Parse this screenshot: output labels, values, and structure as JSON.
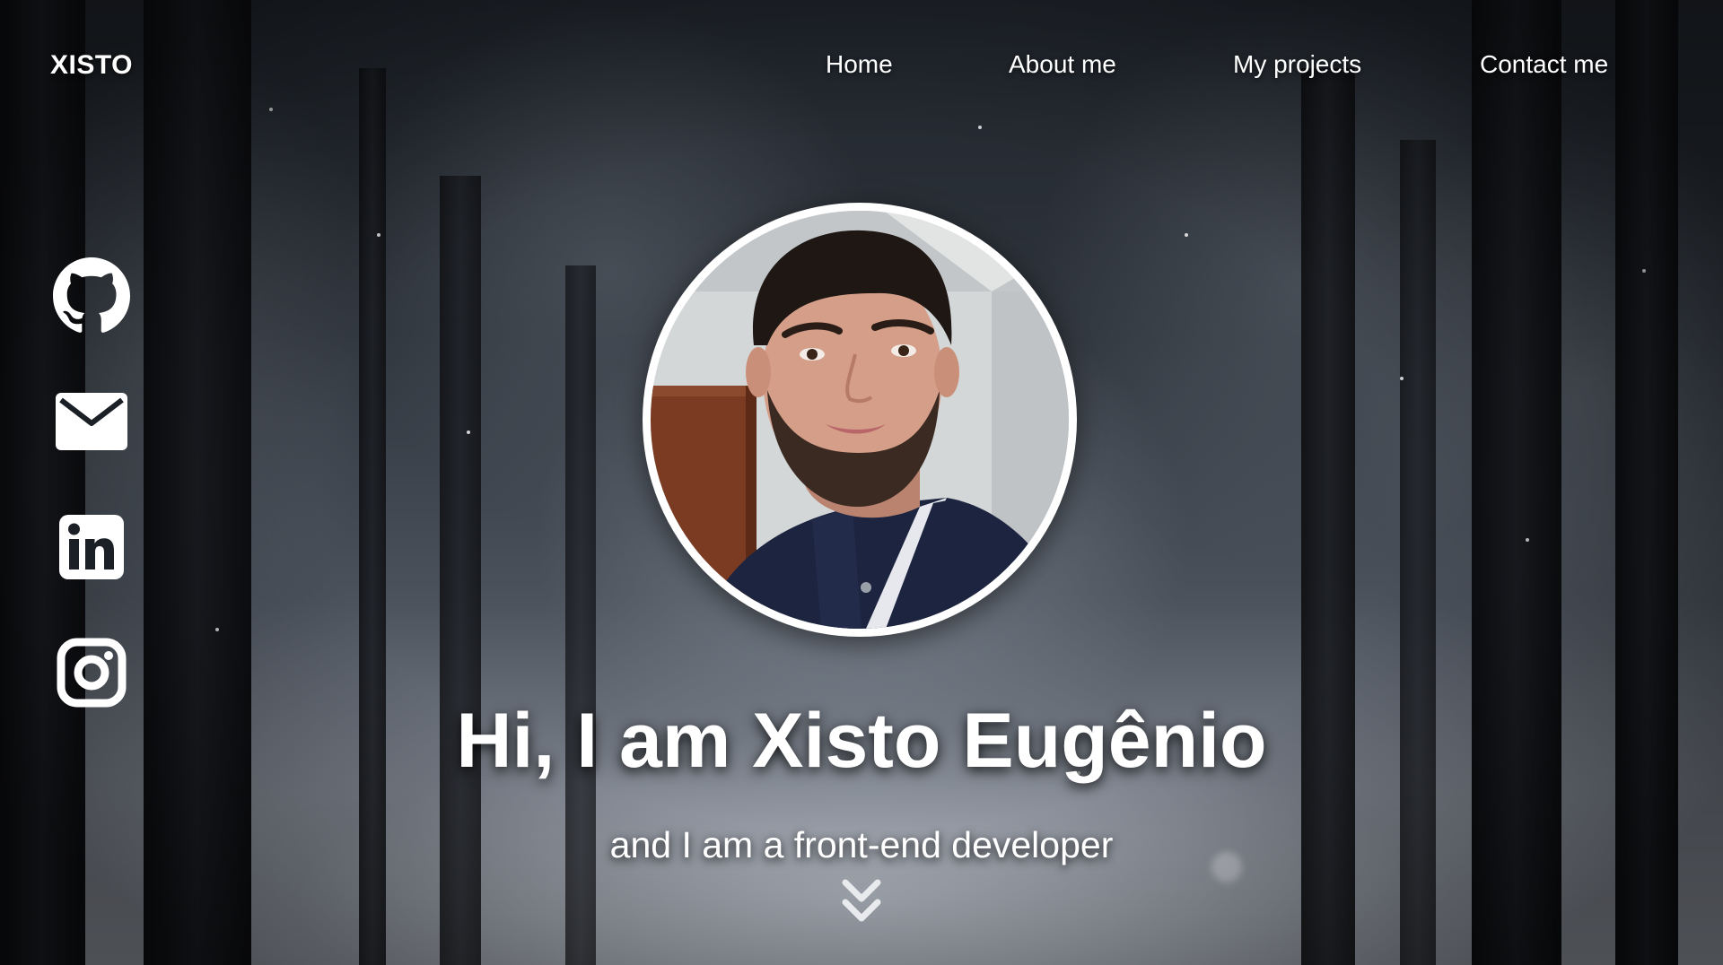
{
  "header": {
    "logo": "XISTO",
    "nav": [
      {
        "label": "Home"
      },
      {
        "label": "About me"
      },
      {
        "label": "My projects"
      },
      {
        "label": "Contact me"
      }
    ]
  },
  "social": [
    {
      "icon": "github-icon"
    },
    {
      "icon": "mail-icon"
    },
    {
      "icon": "linkedin-icon"
    },
    {
      "icon": "instagram-icon"
    }
  ],
  "hero": {
    "title": "Hi, I am Xisto Eugênio",
    "subtitle": "and I am a front-end developer",
    "scroll_icon": "double-chevron-down-icon"
  },
  "colors": {
    "text": "#ffffff",
    "background": "#2f353d"
  }
}
